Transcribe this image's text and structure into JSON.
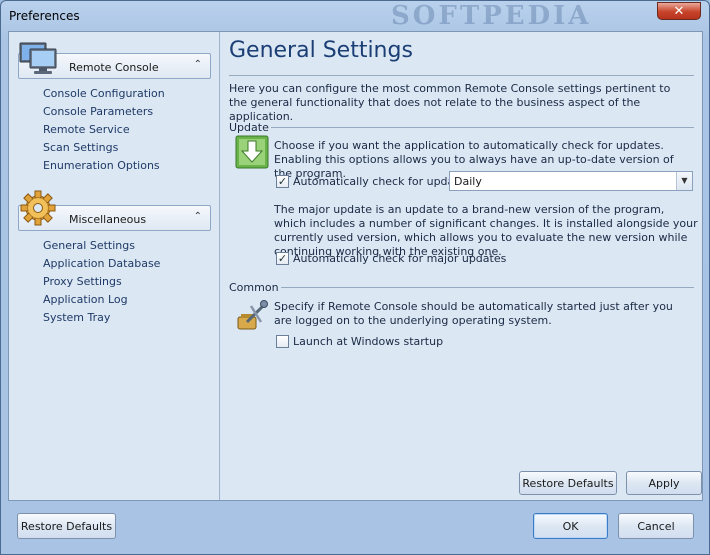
{
  "window": {
    "title": "Preferences",
    "watermark": "SOFTPEDIA",
    "close_glyph": "✕"
  },
  "sidebar": {
    "groups": [
      {
        "label": "Remote Console",
        "icon": "monitor-icon",
        "items": [
          {
            "label": "Console Configuration"
          },
          {
            "label": "Console Parameters"
          },
          {
            "label": "Remote Service"
          },
          {
            "label": "Scan Settings"
          },
          {
            "label": "Enumeration Options"
          }
        ]
      },
      {
        "label": "Miscellaneous",
        "icon": "gear-icon",
        "items": [
          {
            "label": "General Settings"
          },
          {
            "label": "Application Database"
          },
          {
            "label": "Proxy Settings"
          },
          {
            "label": "Application Log"
          },
          {
            "label": "System Tray"
          }
        ]
      }
    ]
  },
  "main": {
    "title": "General Settings",
    "intro": "Here you can configure the most common Remote Console settings pertinent to the general functionality that does not relate to the business aspect of the application.",
    "update": {
      "heading": "Update",
      "description": "Choose if you want the application to automatically check for updates. Enabling this options allows you to always have an up-to-date version of the program.",
      "auto_check_label": "Automatically check for updates:",
      "auto_check_checked": true,
      "frequency_value": "Daily",
      "major_description": "The major update is an update to a brand-new version of the program, which includes a number of significant changes. It is installed alongside your currently used version, which allows you to evaluate the new version while continuing working with the existing one.",
      "major_check_label": "Automatically check for major updates",
      "major_check_checked": true
    },
    "common": {
      "heading": "Common",
      "description": "Specify if Remote Console should be automatically started just after you are logged on to the underlying operating system.",
      "startup_label": "Launch at Windows startup",
      "startup_checked": false
    },
    "buttons": {
      "restore": "Restore Defaults",
      "apply": "Apply"
    }
  },
  "footer": {
    "restore": "Restore Defaults",
    "ok": "OK",
    "cancel": "Cancel"
  },
  "colors": {
    "accent_title": "#1b3f75",
    "nav_text": "#1e3a66",
    "window_frame": "#a8c3e3"
  }
}
